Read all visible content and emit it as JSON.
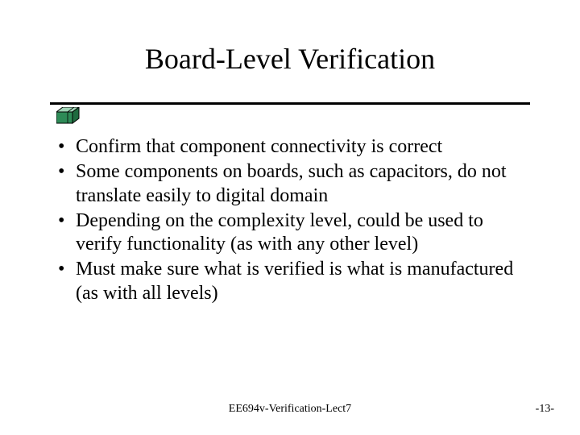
{
  "title": "Board-Level Verification",
  "bullets": [
    "Confirm that component connectivity is correct",
    "Some components on boards, such as capacitors, do not translate easily to digital domain",
    "Depending on the complexity level, could be used to verify functionality (as with any other level)",
    "Must make sure what is verified is what is manufactured (as with all levels)"
  ],
  "footer": {
    "center": "EE694v-Verification-Lect7",
    "right": "-13-"
  }
}
